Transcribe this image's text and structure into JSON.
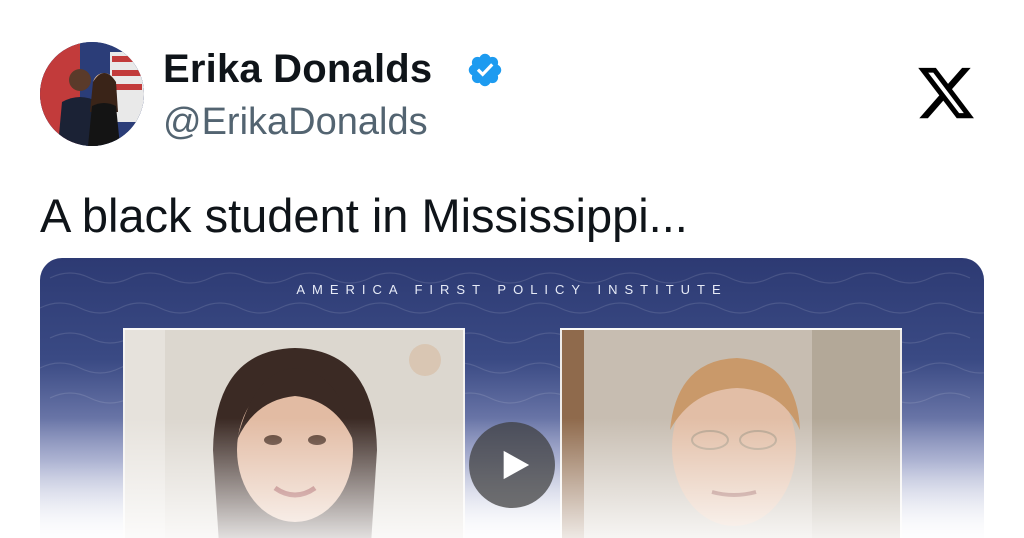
{
  "author": {
    "display_name": "Erika Donalds",
    "handle": "@ErikaDonalds",
    "verified_icon": "verified-badge-icon",
    "avatar_icon": "avatar"
  },
  "platform": {
    "logo_icon": "x-logo-icon"
  },
  "tweet": {
    "text": "A black student in Mississippi..."
  },
  "media": {
    "banner_text": "AMERICA FIRST POLICY INSTITUTE",
    "play_icon": "play-icon"
  },
  "colors": {
    "verified": "#1d9bf0",
    "name": "#0f1419",
    "handle": "#536471",
    "banner": "#2d3a73"
  }
}
